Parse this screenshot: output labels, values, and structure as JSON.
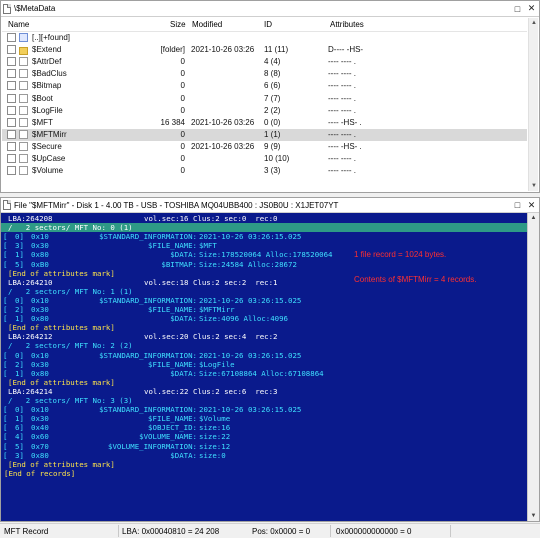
{
  "top_pane": {
    "title": "\\$MetaData",
    "columns": {
      "name": "Name",
      "size": "Size",
      "modified": "Modified",
      "id": "ID",
      "attributes": "Attributes"
    },
    "rows": [
      {
        "name": "[..][+found]",
        "size": "",
        "modified": "",
        "id": "",
        "attributes": "",
        "icon": "up-folder-icon"
      },
      {
        "name": "$Extend",
        "size": "[folder]",
        "modified": "2021-10-26 03:26",
        "id": "11 (11)",
        "attributes": "D---- -HS-",
        "icon": "folder-icon"
      },
      {
        "name": "$AttrDef",
        "size": "0",
        "modified": "",
        "id": "4 (4)",
        "attributes": "---- ----  .",
        "icon": "file-icon"
      },
      {
        "name": "$BadClus",
        "size": "0",
        "modified": "",
        "id": "8 (8)",
        "attributes": "---- ----  .",
        "icon": "file-icon"
      },
      {
        "name": "$Bitmap",
        "size": "0",
        "modified": "",
        "id": "6 (6)",
        "attributes": "---- ----  .",
        "icon": "file-icon"
      },
      {
        "name": "$Boot",
        "size": "0",
        "modified": "",
        "id": "7 (7)",
        "attributes": "---- ----  .",
        "icon": "file-icon"
      },
      {
        "name": "$LogFile",
        "size": "0",
        "modified": "",
        "id": "2 (2)",
        "attributes": "---- ----  .",
        "icon": "file-icon"
      },
      {
        "name": "$MFT",
        "size": "16 384",
        "modified": "2021-10-26 03:26",
        "id": "0 (0)",
        "attributes": "---- -HS-  .",
        "icon": "file-icon"
      },
      {
        "name": "$MFTMirr",
        "size": "0",
        "modified": "",
        "id": "1 (1)",
        "attributes": "---- ----  .",
        "icon": "file-icon",
        "selected": true
      },
      {
        "name": "$Secure",
        "size": "0",
        "modified": "2021-10-26 03:26",
        "id": "9 (9)",
        "attributes": "---- -HS-  .",
        "icon": "file-icon"
      },
      {
        "name": "$UpCase",
        "size": "0",
        "modified": "",
        "id": "10 (10)",
        "attributes": "---- ----  .",
        "icon": "file-icon"
      },
      {
        "name": "$Volume",
        "size": "0",
        "modified": "",
        "id": "3 (3)",
        "attributes": "---- ----  .",
        "icon": "file-icon"
      }
    ]
  },
  "bottom_pane": {
    "title": "File \"$MFTMirr\" - Disk 1 - 4.00 TB - USB - TOSHIBA MQ04UBB400 : JS0B0U : X1JET07YT",
    "lines": [
      {
        "type": "lba",
        "lba": "LBA:264208",
        "vol": "vol.sec:16 Clus:2 sec:0  rec:0"
      },
      {
        "type": "sect",
        "text": "/   2 sectors/ MFT No: 0 (1)",
        "highlight": true
      },
      {
        "type": "attr",
        "num": "0]",
        "hex": "0x10",
        "name": "$STANDARD_INFORMATION:",
        "value": "2021-10-26 03:26:15.025"
      },
      {
        "type": "attr",
        "num": "3]",
        "hex": "0x30",
        "name": "$FILE_NAME:",
        "value": "$MFT"
      },
      {
        "type": "attr",
        "num": "1]",
        "hex": "0x80",
        "name": "$DATA:",
        "value": "Size:178520064 Alloc:178520064"
      },
      {
        "type": "attr",
        "num": "5]",
        "hex": "0xB0",
        "name": "$BITMAP:",
        "value": "Size:24584 Alloc:28672"
      },
      {
        "type": "end",
        "text": "[End of attributes mark]"
      },
      {
        "type": "lba",
        "lba": "LBA:264210",
        "vol": "vol.sec:18 Clus:2 sec:2  rec:1"
      },
      {
        "type": "sect",
        "text": "/   2 sectors/ MFT No: 1 (1)"
      },
      {
        "type": "attr",
        "num": "0]",
        "hex": "0x10",
        "name": "$STANDARD_INFORMATION:",
        "value": "2021-10-26 03:26:15.025"
      },
      {
        "type": "attr",
        "num": "2]",
        "hex": "0x30",
        "name": "$FILE_NAME:",
        "value": "$MFTMirr"
      },
      {
        "type": "attr",
        "num": "1]",
        "hex": "0x80",
        "name": "$DATA:",
        "value": "Size:4096 Alloc:4096"
      },
      {
        "type": "end",
        "text": "[End of attributes mark]"
      },
      {
        "type": "lba",
        "lba": "LBA:264212",
        "vol": "vol.sec:20 Clus:2 sec:4  rec:2"
      },
      {
        "type": "sect",
        "text": "/   2 sectors/ MFT No: 2 (2)"
      },
      {
        "type": "attr",
        "num": "0]",
        "hex": "0x10",
        "name": "$STANDARD_INFORMATION:",
        "value": "2021-10-26 03:26:15.025"
      },
      {
        "type": "attr",
        "num": "2]",
        "hex": "0x30",
        "name": "$FILE_NAME:",
        "value": "$LogFile"
      },
      {
        "type": "attr",
        "num": "1]",
        "hex": "0x80",
        "name": "$DATA:",
        "value": "Size:67108864 Alloc:67108864"
      },
      {
        "type": "end",
        "text": "[End of attributes mark]"
      },
      {
        "type": "lba",
        "lba": "LBA:264214",
        "vol": "vol.sec:22 Clus:2 sec:6  rec:3"
      },
      {
        "type": "sect",
        "text": "/   2 sectors/ MFT No: 3 (3)"
      },
      {
        "type": "attr",
        "num": "0]",
        "hex": "0x10",
        "name": "$STANDARD_INFORMATION:",
        "value": "2021-10-26 03:26:15.025"
      },
      {
        "type": "attr",
        "num": "1]",
        "hex": "0x30",
        "name": "$FILE_NAME:",
        "value": "$Volume"
      },
      {
        "type": "attr",
        "num": "6]",
        "hex": "0x40",
        "name": "$OBJECT_ID:",
        "value": "size:16"
      },
      {
        "type": "attr",
        "num": "4]",
        "hex": "0x60",
        "name": "$VOLUME_NAME:",
        "value": "size:22"
      },
      {
        "type": "attr",
        "num": "5]",
        "hex": "0x70",
        "name": "$VOLUME_INFORMATION:",
        "value": "size:12"
      },
      {
        "type": "attr",
        "num": "3]",
        "hex": "0x80",
        "name": "$DATA:",
        "value": "size:0"
      },
      {
        "type": "end",
        "text": "[End of attributes mark]"
      },
      {
        "type": "endrec",
        "text": "[End of records]"
      }
    ],
    "notes": [
      "1 file record = 1024 bytes.",
      "Contents of $MFTMirr = 4 records."
    ]
  },
  "status_bar": {
    "left": "MFT Record",
    "lba": "LBA: 0x00040810 = 24 208",
    "pos": "Pos: 0x0000 = 0",
    "hex": "0x000000000000 = 0"
  },
  "colors": {
    "console_bg": "#0a1a8c",
    "console_cyan": "#3fe0ff",
    "highlight": "#2e9a86",
    "end_mark": "#ffe54a",
    "note_red": "#ff3030"
  }
}
